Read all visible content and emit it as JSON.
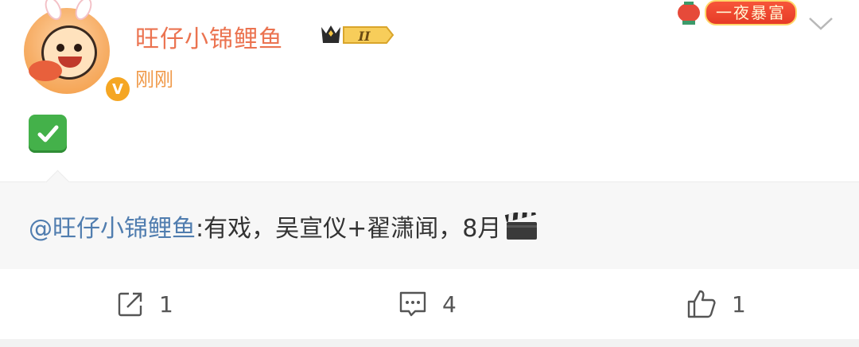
{
  "post": {
    "username": "旺仔小锦鲤鱼",
    "level_badge": "II",
    "timestamp": "刚刚",
    "verified": "V",
    "emoji": "check-mark-button",
    "decoration_text": "一夜暴富"
  },
  "repost": {
    "mention": "@旺仔小锦鲤鱼",
    "text": ":有戏，吴宣仪+翟潇闻，8月"
  },
  "actions": {
    "share_count": "1",
    "comment_count": "4",
    "like_count": "1"
  },
  "colors": {
    "username": "#eb7350",
    "timestamp": "#f09a4a",
    "mention": "#507daf",
    "repost_bg": "#f7f7f7"
  }
}
